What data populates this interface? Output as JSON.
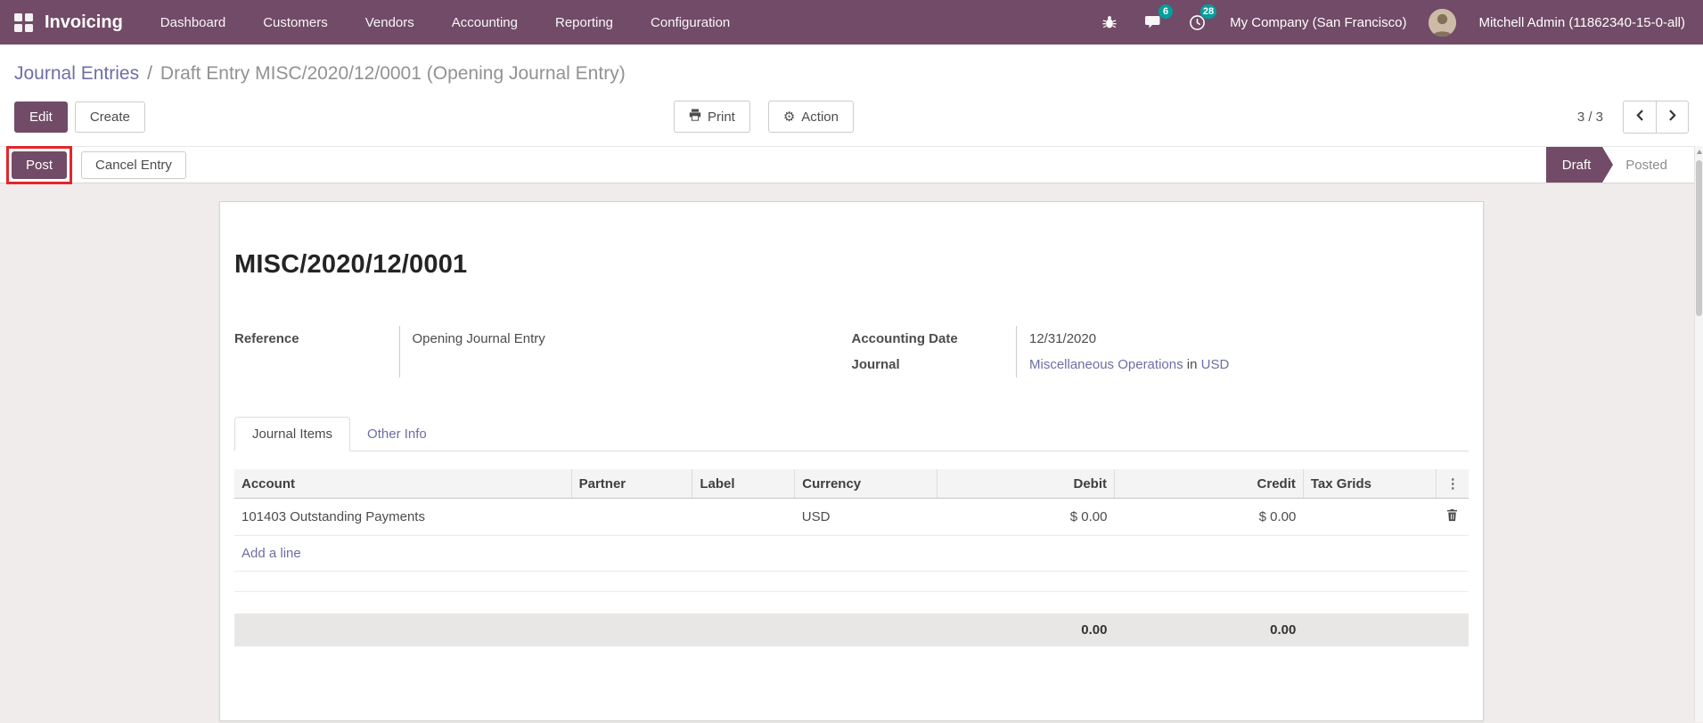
{
  "colors": {
    "brand": "#714B67",
    "link": "#6e6ea6",
    "badge_teal": "#00A09D",
    "annotation_red": "#e5252a",
    "content_background": "#efeceb"
  },
  "nav": {
    "app_name": "Invoicing",
    "menu": [
      "Dashboard",
      "Customers",
      "Vendors",
      "Accounting",
      "Reporting",
      "Configuration"
    ],
    "messages_badge": "6",
    "activities_badge": "28",
    "company": "My Company (San Francisco)",
    "user": "Mitchell Admin (11862340-15-0-all)"
  },
  "breadcrumb": {
    "parent": "Journal Entries",
    "separator": "/",
    "current": "Draft Entry MISC/2020/12/0001 (Opening Journal Entry)"
  },
  "control_panel": {
    "edit": "Edit",
    "create": "Create",
    "print": "Print",
    "action": "Action",
    "pager": "3 / 3"
  },
  "statusbar": {
    "post": "Post",
    "cancel_entry": "Cancel Entry",
    "states": [
      {
        "label": "Draft",
        "active": true
      },
      {
        "label": "Posted",
        "active": false
      }
    ]
  },
  "sheet": {
    "title": "MISC/2020/12/0001",
    "fields": {
      "reference": {
        "label": "Reference",
        "value": "Opening Journal Entry"
      },
      "accounting_date": {
        "label": "Accounting Date",
        "value": "12/31/2020"
      },
      "journal": {
        "label": "Journal",
        "value": "Miscellaneous Operations",
        "connector": "in",
        "currency": "USD"
      }
    },
    "tabs": [
      {
        "label": "Journal Items",
        "active": true
      },
      {
        "label": "Other Info",
        "active": false
      }
    ],
    "table": {
      "headers": [
        "Account",
        "Partner",
        "Label",
        "Currency",
        "Debit",
        "Credit",
        "Tax Grids"
      ],
      "kebab": "⋮",
      "rows": [
        {
          "account": "101403 Outstanding Payments",
          "partner": "",
          "label": "",
          "currency": "USD",
          "debit": "$ 0.00",
          "credit": "$ 0.00",
          "tax_grids": ""
        }
      ],
      "add_line": "Add a line",
      "totals": {
        "debit": "0.00",
        "credit": "0.00"
      }
    }
  }
}
